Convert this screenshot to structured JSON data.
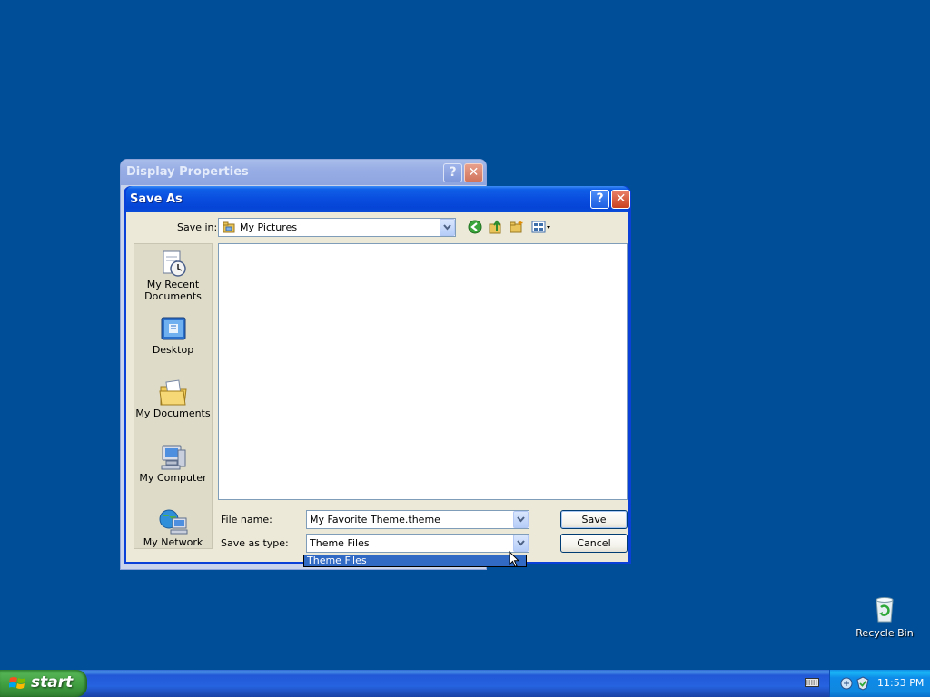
{
  "background_window": {
    "title": "Display Properties",
    "help_glyph": "?",
    "close_glyph": "✕"
  },
  "dialog": {
    "title": "Save As",
    "help_glyph": "?",
    "close_glyph": "✕",
    "save_in_label": "Save in:",
    "save_in_value": "My Pictures",
    "places": [
      {
        "label_line1": "My Recent",
        "label_line2": "Documents",
        "icon": "recent-documents-icon"
      },
      {
        "label_line1": "Desktop",
        "label_line2": "",
        "icon": "desktop-icon"
      },
      {
        "label_line1": "My Documents",
        "label_line2": "",
        "icon": "my-documents-icon"
      },
      {
        "label_line1": "My Computer",
        "label_line2": "",
        "icon": "my-computer-icon"
      },
      {
        "label_line1": "My Network",
        "label_line2": "",
        "icon": "my-network-icon"
      }
    ],
    "file_name_label": "File name:",
    "file_name_value": "My Favorite Theme.theme",
    "save_as_type_label": "Save as type:",
    "save_as_type_value": "Theme Files",
    "save_as_type_options": [
      "Theme Files"
    ],
    "save_button": "Save",
    "cancel_button": "Cancel"
  },
  "desktop": {
    "recycle_bin_label": "Recycle Bin"
  },
  "taskbar": {
    "start_label": "start",
    "clock": "11:53 PM"
  },
  "colors": {
    "desktop_bg": "#004e98",
    "titlebar_active": "#0a4fe0",
    "selection": "#316ac5",
    "start_green": "#3e9b3e"
  }
}
